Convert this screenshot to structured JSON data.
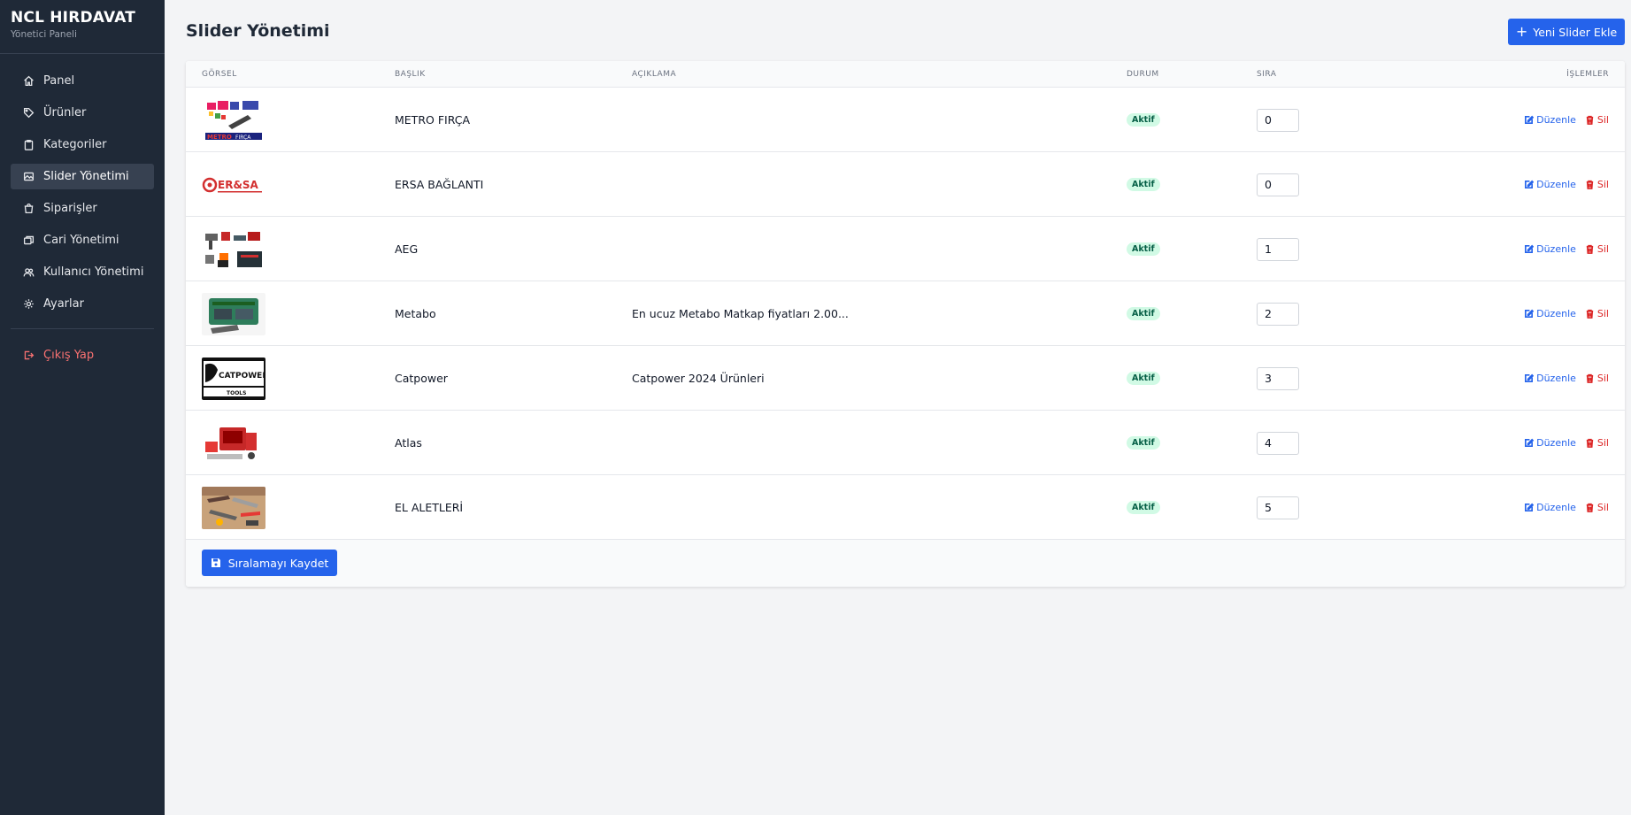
{
  "brand": {
    "title": "NCL HIRDAVAT",
    "subtitle": "Yönetici Paneli"
  },
  "sidebar": {
    "items": [
      {
        "label": "Panel",
        "icon": "home-icon"
      },
      {
        "label": "Ürünler",
        "icon": "tag-icon"
      },
      {
        "label": "Kategoriler",
        "icon": "clipboard-icon"
      },
      {
        "label": "Slider Yönetimi",
        "icon": "image-icon",
        "active": true
      },
      {
        "label": "Siparişler",
        "icon": "shopping-bag-icon"
      },
      {
        "label": "Cari Yönetimi",
        "icon": "layers-icon"
      },
      {
        "label": "Kullanıcı Yönetimi",
        "icon": "users-icon"
      },
      {
        "label": "Ayarlar",
        "icon": "gear-icon"
      }
    ],
    "logout": {
      "label": "Çıkış Yap",
      "icon": "logout-icon"
    }
  },
  "header": {
    "title": "Slider Yönetimi",
    "add_button": "Yeni Slider Ekle"
  },
  "table": {
    "columns": {
      "image": "GÖRSEL",
      "title": "BAŞLIK",
      "description": "AÇIKLAMA",
      "status": "DURUM",
      "order": "SIRA",
      "actions": "İŞLEMLER"
    },
    "edit_label": "Düzenle",
    "delete_label": "Sil",
    "rows": [
      {
        "thumb": "metro",
        "title": "METRO FIRÇA",
        "description": "",
        "status": "Aktif",
        "order": "0"
      },
      {
        "thumb": "ersa",
        "title": "ERSA BAĞLANTI",
        "description": "",
        "status": "Aktif",
        "order": "0"
      },
      {
        "thumb": "aeg",
        "title": "AEG",
        "description": "",
        "status": "Aktif",
        "order": "1"
      },
      {
        "thumb": "metabo",
        "title": "Metabo",
        "description": "En ucuz Metabo Matkap fiyatları 2.00...",
        "status": "Aktif",
        "order": "2"
      },
      {
        "thumb": "catpower",
        "title": "Catpower",
        "description": "Catpower 2024 Ürünleri",
        "status": "Aktif",
        "order": "3"
      },
      {
        "thumb": "atlas",
        "title": "Atlas",
        "description": "",
        "status": "Aktif",
        "order": "4"
      },
      {
        "thumb": "el-aletleri",
        "title": "EL ALETLERİ",
        "description": "",
        "status": "Aktif",
        "order": "5"
      }
    ],
    "thumb_text": {
      "metro_a": "METRO",
      "metro_b": "FIRÇA",
      "ersa": "ER&SA",
      "catpower_a": "CATPOWER",
      "catpower_b": "TOOLS"
    },
    "save_button": "Sıralamayı Kaydet"
  },
  "colors": {
    "sidebar_bg": "#1f2937",
    "accent": "#2563eb",
    "danger": "#dc2626",
    "badge_bg": "#d1fae5",
    "badge_text": "#065f46"
  }
}
